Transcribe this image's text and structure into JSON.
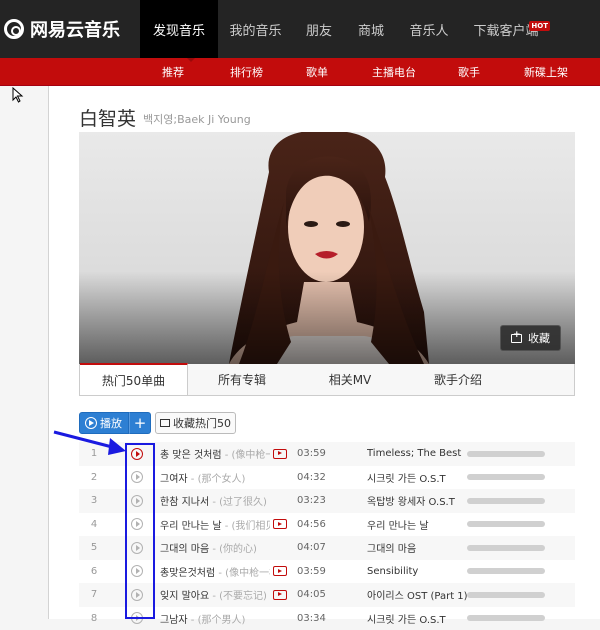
{
  "brand": {
    "name": "网易云音乐"
  },
  "nav": [
    {
      "label": "发现音乐",
      "active": true
    },
    {
      "label": "我的音乐"
    },
    {
      "label": "朋友"
    },
    {
      "label": "商城"
    },
    {
      "label": "音乐人"
    },
    {
      "label": "下载客户端",
      "badge": "HOT"
    }
  ],
  "subnav": [
    {
      "label": "推荐",
      "active": true
    },
    {
      "label": "排行榜"
    },
    {
      "label": "歌单"
    },
    {
      "label": "主播电台"
    },
    {
      "label": "歌手"
    },
    {
      "label": "新碟上架"
    }
  ],
  "artist": {
    "name": "白智英",
    "alias": "백지영;Baek Ji Young"
  },
  "photo": {
    "collect_label": "收藏"
  },
  "tabs": [
    {
      "label": "热门50单曲",
      "active": true
    },
    {
      "label": "所有专辑"
    },
    {
      "label": "相关MV"
    },
    {
      "label": "歌手介绍"
    }
  ],
  "actions": {
    "play_label": "播放",
    "add_label": "+",
    "collect_hot_label": "收藏热门50"
  },
  "songs": [
    {
      "index": "1",
      "title": "총 맞은 것처럼",
      "sub": " - (像中枪一样)",
      "mv": true,
      "duration": "03:59",
      "album": "Timeless; The Best",
      "active": true
    },
    {
      "index": "2",
      "title": "그여자",
      "sub": " - (那个女人)",
      "mv": false,
      "duration": "04:32",
      "album": "시크릿 가든 O.S.T"
    },
    {
      "index": "3",
      "title": "한참 지나서",
      "sub": " - (过了很久)",
      "mv": false,
      "duration": "03:23",
      "album": "옥탑방 왕세자 O.S.T"
    },
    {
      "index": "4",
      "title": "우리 만나는 날",
      "sub": " - (我们相见的日子)",
      "mv": true,
      "duration": "04:56",
      "album": "우리 만나는 날"
    },
    {
      "index": "5",
      "title": "그대의 마음",
      "sub": " - (你的心)",
      "mv": false,
      "duration": "04:07",
      "album": "그대의 마음"
    },
    {
      "index": "6",
      "title": "총맞은것처럼",
      "sub": " - (像中枪一样)",
      "mv": true,
      "duration": "03:59",
      "album": "Sensibility"
    },
    {
      "index": "7",
      "title": "잊지 말아요",
      "sub": " - (不要忘记)",
      "mv": true,
      "duration": "04:05",
      "album": "아이리스 OST (Part 1)"
    },
    {
      "index": "8",
      "title": "그남자",
      "sub": " - (那个男人)",
      "mv": false,
      "duration": "03:34",
      "album": "시크릿 가든 O.S.T"
    }
  ],
  "colors": {
    "brand_red": "#c20c0c",
    "nav_bg": "#242424",
    "play_blue": "#2d7fd3",
    "annotation_blue": "#1a1ae0"
  }
}
